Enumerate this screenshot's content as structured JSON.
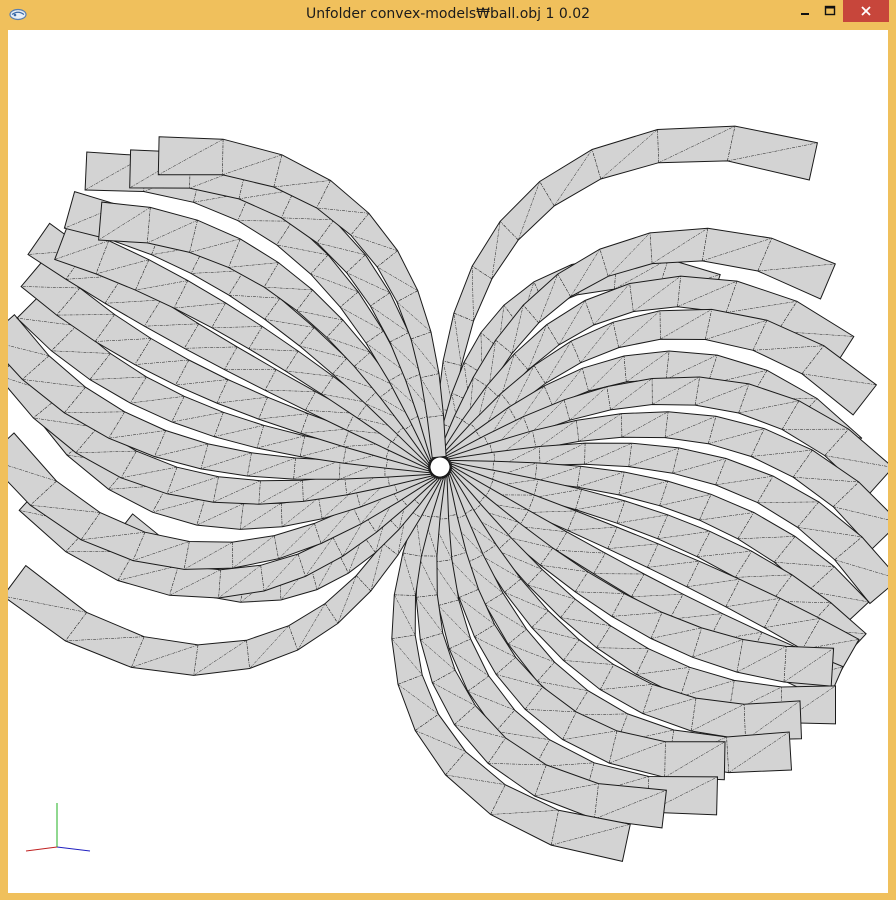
{
  "window": {
    "title": "Unfolder convex-models₩ball.obj 1 0.02",
    "app_icon": "app-logo-icon",
    "controls": {
      "minimize": "minimize-icon",
      "maximize": "maximize-icon",
      "close": "close-icon"
    },
    "colors": {
      "frame": "#f0c05c",
      "close_button": "#c7463b",
      "canvas": "#ffffff"
    }
  },
  "viewport": {
    "content": "unfolded-mesh",
    "mesh": {
      "fill_color": "#d3d3d3",
      "edge_color": "#1a1a1a",
      "fold_line_style": "dash-dot",
      "petals": [
        {
          "len": 45,
          "bend": 0.8
        },
        {
          "len": 30,
          "bend": 0.75
        },
        {
          "len": 40,
          "bend": 0.7
        },
        {
          "len": 39,
          "bend": 0.7
        },
        {
          "len": 40,
          "bend": 0.65
        },
        {
          "len": 38,
          "bend": 0.6
        },
        {
          "len": 41,
          "bend": 0.5
        },
        {
          "len": 42,
          "bend": 0.45
        },
        {
          "len": 43,
          "bend": 0.4
        },
        {
          "len": 41,
          "bend": 0.3
        },
        {
          "len": 42,
          "bend": 0.2
        },
        {
          "len": 42,
          "bend": 0.05
        },
        {
          "len": 42,
          "bend": -0.05
        },
        {
          "len": 41,
          "bend": -0.25
        },
        {
          "len": 43,
          "bend": -0.35
        },
        {
          "len": 41,
          "bend": -0.45
        },
        {
          "len": 42,
          "bend": -0.55
        },
        {
          "len": 38,
          "bend": -0.6
        },
        {
          "len": 40,
          "bend": -0.7
        },
        {
          "len": 38,
          "bend": -0.75
        },
        {
          "len": 39,
          "bend": -0.8
        },
        {
          "len": 41,
          "bend": 0.8
        },
        {
          "len": 30,
          "bend": 0.7
        },
        {
          "len": 38,
          "bend": 0.65
        },
        {
          "len": 41,
          "bend": 0.6
        },
        {
          "len": 37,
          "bend": 0.55
        },
        {
          "len": 41,
          "bend": 0.45
        },
        {
          "len": 43,
          "bend": 0.35
        },
        {
          "len": 41,
          "bend": 0.25
        },
        {
          "len": 42,
          "bend": 0.15
        },
        {
          "len": 43,
          "bend": 0.05
        },
        {
          "len": 41,
          "bend": -0.1
        },
        {
          "len": 42,
          "bend": -0.2
        },
        {
          "len": 39,
          "bend": -0.35
        },
        {
          "len": 43,
          "bend": -0.45
        },
        {
          "len": 40,
          "bend": -0.55
        },
        {
          "len": 39,
          "bend": -0.65
        }
      ]
    },
    "axes_gizmo": {
      "x_color": "#2020c0",
      "y_color": "#20b020",
      "z_color": "#c02020"
    }
  }
}
